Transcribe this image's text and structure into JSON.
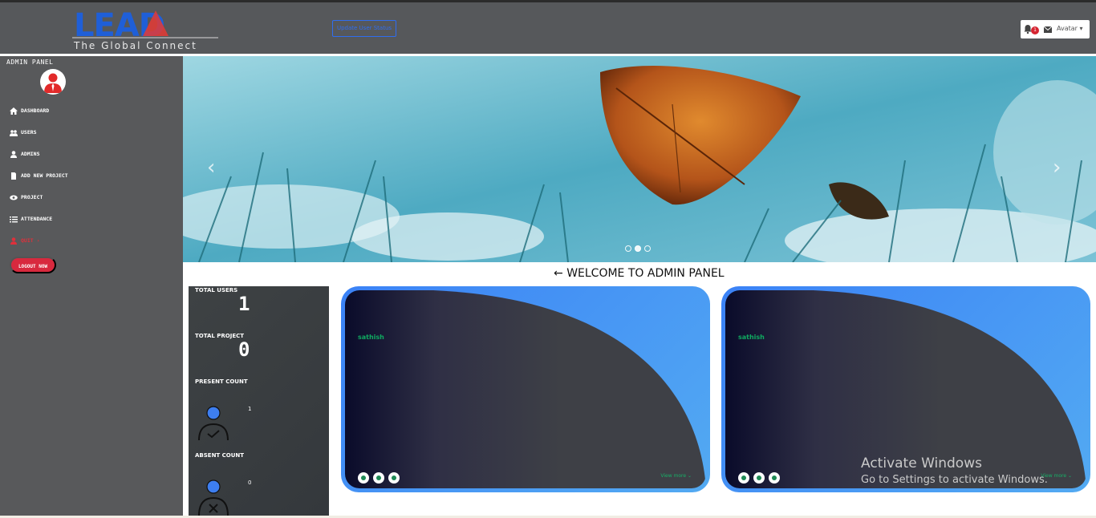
{
  "header": {
    "logo_text": "LEAD",
    "logo_tagline": "The Global Connect",
    "update_status_label": "Update User Status",
    "notification_count": "1",
    "avatar_alt": "Avatar"
  },
  "sidebar": {
    "title": "ADMIN PANEL",
    "items": [
      {
        "label": "DASHBOARD",
        "icon": "home-icon",
        "color": "#ffffff"
      },
      {
        "label": "USERS",
        "icon": "users-icon",
        "color": "#ffffff"
      },
      {
        "label": "ADMINS",
        "icon": "user-icon",
        "color": "#ffffff"
      },
      {
        "label": "ADD NEW PROJECT",
        "icon": "file-icon",
        "color": "#ffffff"
      },
      {
        "label": "PROJECT",
        "icon": "eye-icon",
        "color": "#ffffff"
      },
      {
        "label": "ATTENDANCE",
        "icon": "list-icon",
        "color": "#ffffff"
      },
      {
        "label": "QUIT",
        "icon": "user-icon",
        "color": "#e0303b"
      }
    ],
    "logout_label": "LOGOUT NOW"
  },
  "carousel": {
    "prev_icon": "chevron-left-icon",
    "next_icon": "chevron-right-icon",
    "slides": 3,
    "active_slide": 2
  },
  "main": {
    "welcome": "WELCOME TO ADMIN PANEL"
  },
  "stats": {
    "total_users_label": "TOTAL USERS",
    "total_users_value": "1",
    "total_project_label": "TOTAL PROJECT",
    "total_project_value": "0",
    "present_label": "PRESENT COUNT",
    "present_value": "1",
    "absent_label": "ABSENT COUNT",
    "absent_value": "0"
  },
  "cards": [
    {
      "name": "sathish",
      "view_more": "View more"
    },
    {
      "name": "sathish",
      "view_more": "View more"
    }
  ],
  "watermark": {
    "line1": "Activate Windows",
    "line2": "Go to Settings to activate Windows."
  },
  "colors": {
    "header_bg": "#56585b",
    "sidebar_bg": "#58595b",
    "accent_blue": "#3b82f6",
    "logout_red": "#d8293e",
    "name_green": "#0faa60"
  }
}
